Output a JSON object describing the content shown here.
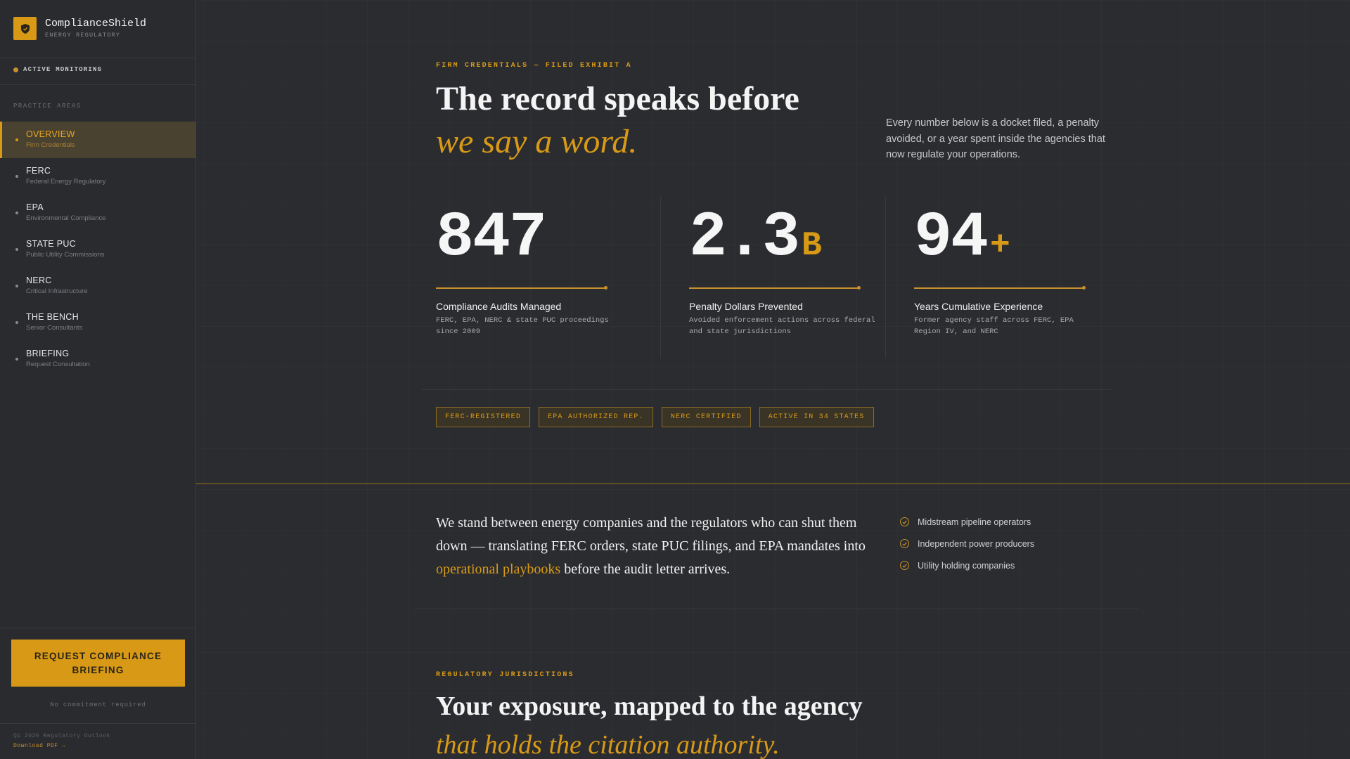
{
  "brand": {
    "name": "ComplianceShield",
    "subtitle": "ENERGY REGULATORY"
  },
  "status": {
    "label": "ACTIVE MONITORING"
  },
  "sidebar": {
    "section_title": "PRACTICE AREAS",
    "items": [
      {
        "label": "OVERVIEW",
        "sub": "Firm Credentials",
        "active": true
      },
      {
        "label": "FERC",
        "sub": "Federal Energy Regulatory"
      },
      {
        "label": "EPA",
        "sub": "Environmental Compliance"
      },
      {
        "label": "STATE PUC",
        "sub": "Public Utility Commissions"
      },
      {
        "label": "NERC",
        "sub": "Critical Infrastructure"
      },
      {
        "label": "THE BENCH",
        "sub": "Senior Consultants"
      },
      {
        "label": "BRIEFING",
        "sub": "Request Consultation"
      }
    ],
    "cta_line1": "REQUEST COMPLIANCE",
    "cta_line2": "BRIEFING",
    "cta_note": "No commitment required",
    "outlook": "Q1 2026 Regulatory Outlook",
    "download": "Download PDF →"
  },
  "hero": {
    "eyebrow": "FIRM CREDENTIALS — FILED EXHIBIT A",
    "line1": "The record speaks before",
    "line2": "we say a word.",
    "description": "Every number below is a docket filed, a penalty avoided, or a year spent inside the agencies that now regulate your operations."
  },
  "stats": [
    {
      "value": "847",
      "suffix": "",
      "label": "Compliance Audits Managed",
      "note": "FERC, EPA, NERC & state PUC proceedings since 2009"
    },
    {
      "value": "2.3",
      "suffix": "B",
      "label": "Penalty Dollars Prevented",
      "note": "Avoided enforcement actions across federal and state jurisdictions"
    },
    {
      "value": "94",
      "suffix": "+",
      "label": "Years Cumulative Experience",
      "note": "Former agency staff across FERC, EPA Region IV, and NERC"
    }
  ],
  "badges": [
    "FERC-REGISTERED",
    "EPA AUTHORIZED REP.",
    "NERC CERTIFIED",
    "ACTIVE IN 34 STATES"
  ],
  "statement": {
    "before": "We stand between energy companies and the regulators who can shut them down — translating FERC orders, state PUC filings, and EPA mandates into ",
    "highlight": "operational playbooks",
    "after": " before the audit letter arrives."
  },
  "clients": [
    "Midstream pipeline operators",
    "Independent power producers",
    "Utility holding companies"
  ],
  "section2": {
    "eyebrow": "REGULATORY JURISDICTIONS",
    "line1": "Your exposure, mapped to the agency",
    "line2": "that holds the citation authority."
  }
}
